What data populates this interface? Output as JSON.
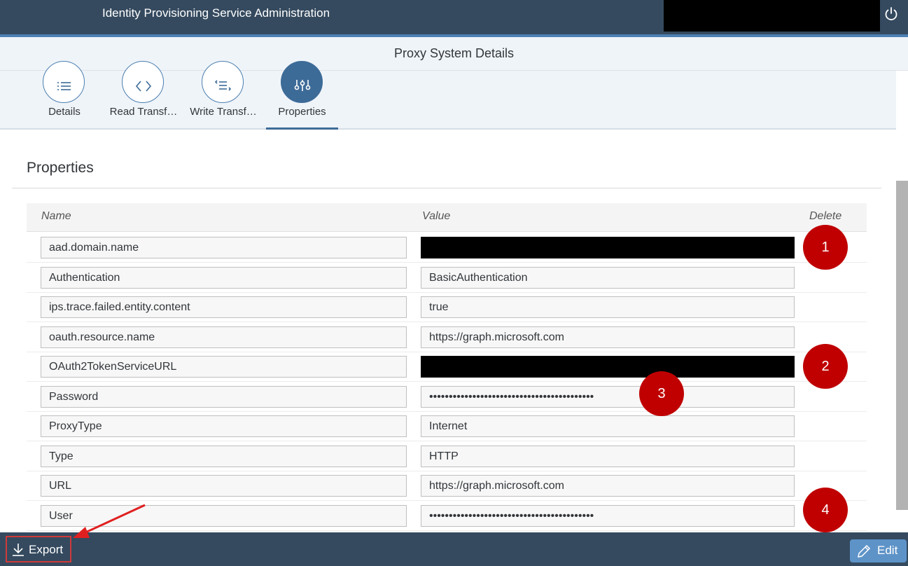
{
  "header": {
    "title": "Identity Provisioning Service Administration"
  },
  "subheader": {
    "title": "Proxy System Details"
  },
  "tabs": [
    {
      "label": "Details",
      "icon": "list-icon"
    },
    {
      "label": "Read Transf…",
      "icon": "code-icon"
    },
    {
      "label": "Write Transf…",
      "icon": "write-transform-icon"
    },
    {
      "label": "Properties",
      "icon": "sliders-icon",
      "active": true
    }
  ],
  "section": {
    "title": "Properties"
  },
  "table": {
    "columns": {
      "name": "Name",
      "value": "Value",
      "delete": "Delete"
    },
    "rows": [
      {
        "name": "aad.domain.name",
        "value": "",
        "redacted": true
      },
      {
        "name": "Authentication",
        "value": "BasicAuthentication"
      },
      {
        "name": "ips.trace.failed.entity.content",
        "value": "true"
      },
      {
        "name": "oauth.resource.name",
        "value": "https://graph.microsoft.com"
      },
      {
        "name": "OAuth2TokenServiceURL",
        "value": "",
        "redacted": true
      },
      {
        "name": "Password",
        "value": "••••••••••••••••••••••••••••••••••••••••••"
      },
      {
        "name": "ProxyType",
        "value": "Internet"
      },
      {
        "name": "Type",
        "value": "HTTP"
      },
      {
        "name": "URL",
        "value": "https://graph.microsoft.com"
      },
      {
        "name": "User",
        "value": "••••••••••••••••••••••••••••••••••••••••••"
      }
    ]
  },
  "annotations": [
    "1",
    "2",
    "3",
    "4"
  ],
  "footer": {
    "export_label": "Export",
    "edit_label": "Edit"
  },
  "colors": {
    "shell": "#354a5f",
    "accent": "#3d6b98",
    "annotation": "#c00000",
    "edit_button": "#5e93c8"
  }
}
